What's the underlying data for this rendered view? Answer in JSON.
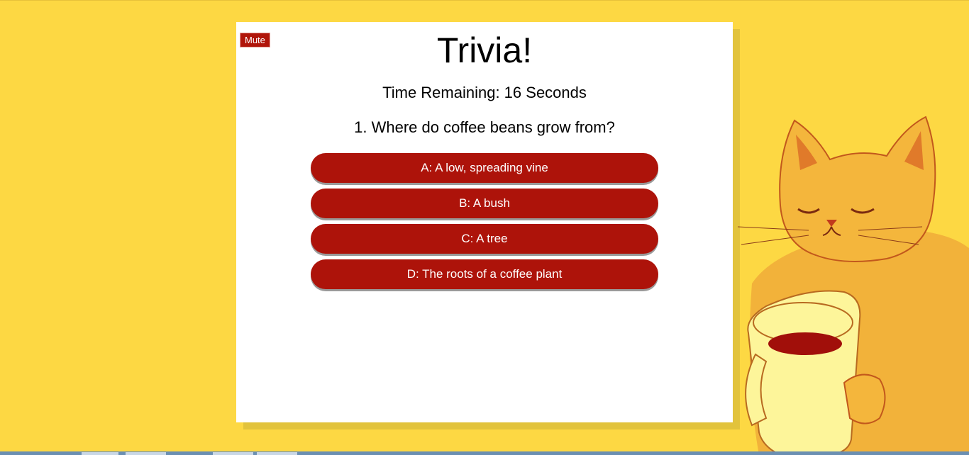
{
  "header": {
    "title": "Trivia!",
    "mute_label": "Mute"
  },
  "timer": {
    "text": "Time Remaining: 16 Seconds"
  },
  "question": {
    "text": "1. Where do coffee beans grow from?"
  },
  "answers": [
    {
      "label": "A: A low, spreading vine"
    },
    {
      "label": "B: A bush"
    },
    {
      "label": "C: A tree"
    },
    {
      "label": "D: The roots of a coffee plant"
    }
  ],
  "colors": {
    "background": "#fdd843",
    "card": "#ffffff",
    "accent": "#ad130a"
  },
  "decor": {
    "illustration": "cat-with-coffee-mug-illustration"
  }
}
